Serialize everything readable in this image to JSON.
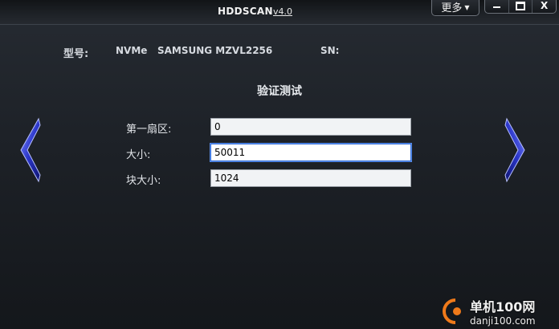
{
  "titlebar": {
    "app_name": "HDDSCAN",
    "version": "v4.0",
    "more_label": "更多",
    "minimize_icon": "minimize-icon",
    "maximize_icon": "maximize-icon",
    "close_label": "X"
  },
  "device": {
    "model_label": "型号:",
    "model_value": "NVMe   SAMSUNG MZVL2256",
    "sn_label": "SN:"
  },
  "test": {
    "title": "验证测试",
    "fields": [
      {
        "label": "第一扇区:",
        "value": "0"
      },
      {
        "label": "大小:",
        "value": "50011"
      },
      {
        "label": "块大小:",
        "value": "1024"
      }
    ]
  },
  "nav": {
    "prev_icon": "chevron-left-icon",
    "next_icon": "chevron-right-icon"
  },
  "watermark": {
    "name": "单机100网",
    "url": "danji100.com"
  },
  "colors": {
    "accent_blue": "#2f3fd8",
    "focus_border": "#2f6bd8"
  }
}
